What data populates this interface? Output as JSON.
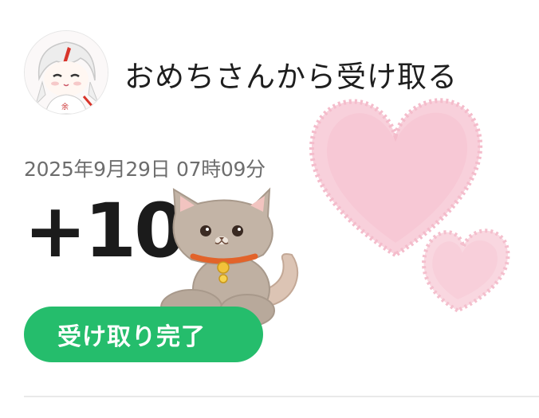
{
  "sender": {
    "title": "おめちさんから受け取る",
    "avatar_icon": "character-avatar-icon"
  },
  "transaction": {
    "datetime": "2025年9月29日 07時09分",
    "amount": "+10",
    "status_label": "受け取り完了"
  },
  "decorations": {
    "cat_sticker": "cat-sticker-icon",
    "hearts": "pink-hearts-icon"
  },
  "colors": {
    "accent": "#25bd6c",
    "heart": "#f5c6d2"
  }
}
